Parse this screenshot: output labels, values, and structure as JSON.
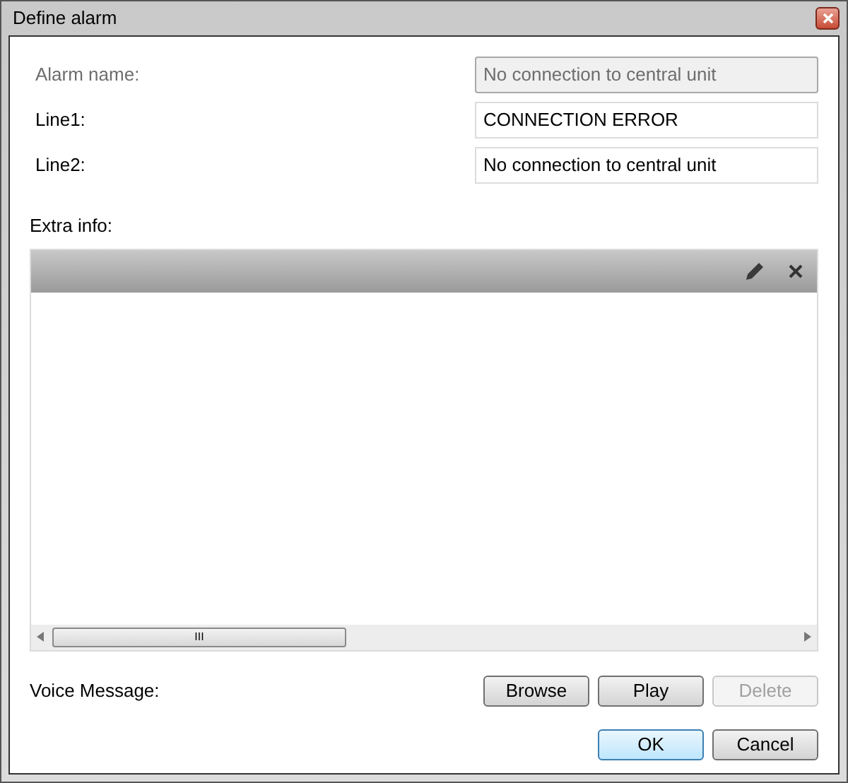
{
  "window": {
    "title": "Define alarm"
  },
  "fields": [
    {
      "label": "Alarm name:",
      "value": "No connection to central unit",
      "disabled": true
    },
    {
      "label": "Line1:",
      "value": "CONNECTION ERROR",
      "disabled": false
    },
    {
      "label": "Line2:",
      "value": "No connection to central unit",
      "disabled": false
    }
  ],
  "extra_info": {
    "label": "Extra info:",
    "scroll_glyph": "III"
  },
  "voice": {
    "label": "Voice Message:",
    "buttons": [
      {
        "label": "Browse",
        "disabled": false
      },
      {
        "label": "Play",
        "disabled": false
      },
      {
        "label": "Delete",
        "disabled": true
      }
    ]
  },
  "dialog_buttons": [
    {
      "label": "OK",
      "default": true
    },
    {
      "label": "Cancel",
      "default": false
    }
  ]
}
